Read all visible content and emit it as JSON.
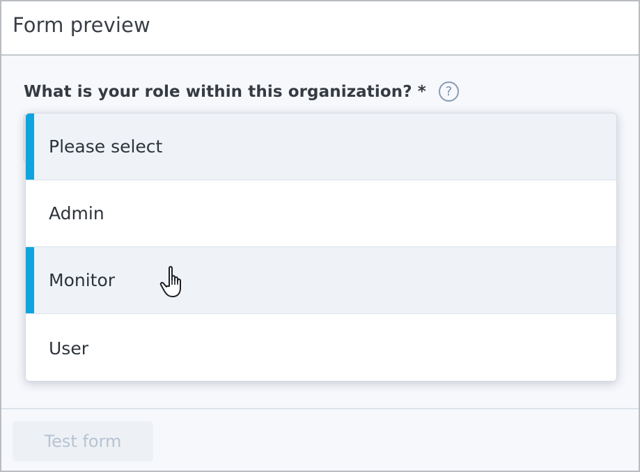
{
  "header": {
    "title": "Form preview"
  },
  "question": {
    "label": "What is your role within this organization? *",
    "help_icon": "?"
  },
  "dropdown": {
    "options": [
      {
        "label": "Please select",
        "highlighted": true
      },
      {
        "label": "Admin",
        "highlighted": false
      },
      {
        "label": "Monitor",
        "highlighted": true
      },
      {
        "label": "User",
        "highlighted": false
      }
    ],
    "hovered": "Monitor"
  },
  "footer": {
    "test_button_label": "Test form"
  },
  "colors": {
    "accent": "#0ea4e0",
    "highlight_bg": "#eff3f8",
    "text": "#2e333a"
  },
  "icons": {
    "help": "question-circle-icon",
    "cursor": "hand-pointer-icon"
  }
}
